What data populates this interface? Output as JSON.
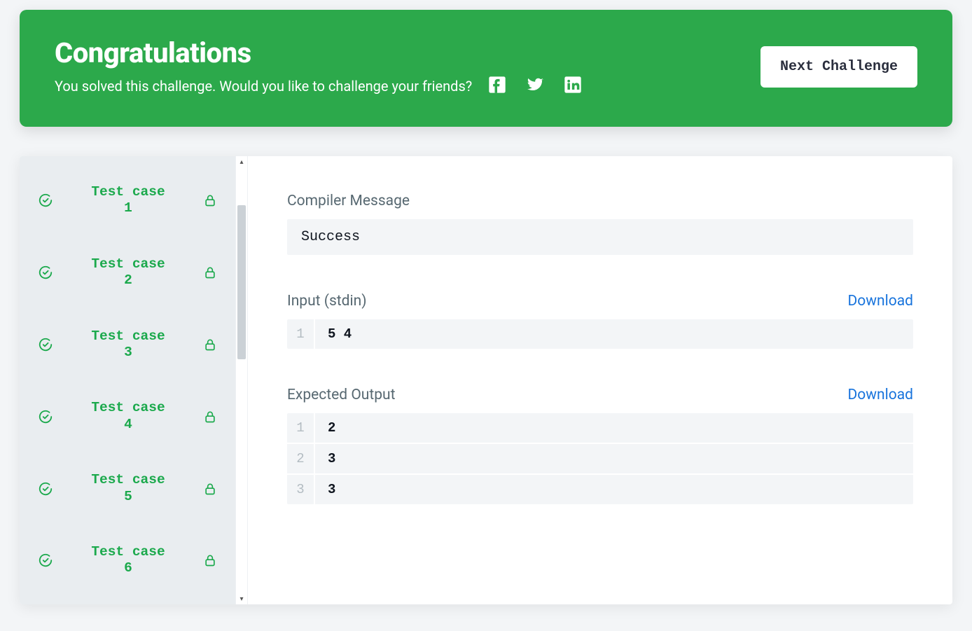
{
  "banner": {
    "title": "Congratulations",
    "subtitle": "You solved this challenge. Would you like to challenge your friends?",
    "next_button": "Next Challenge"
  },
  "sidebar": {
    "test_cases": [
      {
        "label": "Test case 1",
        "passed": true,
        "locked": true
      },
      {
        "label": "Test case 2",
        "passed": true,
        "locked": true
      },
      {
        "label": "Test case 3",
        "passed": true,
        "locked": true
      },
      {
        "label": "Test case 4",
        "passed": true,
        "locked": true
      },
      {
        "label": "Test case 5",
        "passed": true,
        "locked": true
      },
      {
        "label": "Test case 6",
        "passed": true,
        "locked": true
      }
    ]
  },
  "detail": {
    "compiler_label": "Compiler Message",
    "compiler_message": "Success",
    "input_label": "Input (stdin)",
    "input_download": "Download",
    "input_lines": [
      "5 4"
    ],
    "output_label": "Expected Output",
    "output_download": "Download",
    "output_lines": [
      "2",
      "3",
      "3"
    ]
  }
}
